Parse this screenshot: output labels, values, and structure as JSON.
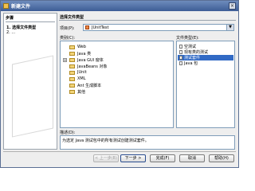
{
  "window": {
    "title": "新建文件"
  },
  "steps": {
    "title": "步骤",
    "items": [
      {
        "num": "1.",
        "label": "选择文件类型",
        "current": true
      },
      {
        "num": "2.",
        "label": "...",
        "current": false
      }
    ]
  },
  "main": {
    "title": "选择文件类型",
    "project_label": "项目(P):",
    "project_value": "JUnitTest",
    "categories_label": "类别(C):",
    "file_types_label": "文件类型(E):",
    "categories": [
      {
        "label": "Web",
        "expandable": false
      },
      {
        "label": "Java 类",
        "expandable": false
      },
      {
        "label": "Java GUI 窗体",
        "expandable": true
      },
      {
        "label": "JavaBeans 对象",
        "expandable": false
      },
      {
        "label": "JUnit",
        "expandable": false
      },
      {
        "label": "XML",
        "expandable": false
      },
      {
        "label": "Ant 生成脚本",
        "expandable": false
      },
      {
        "label": "其他",
        "expandable": false
      }
    ],
    "file_types": [
      {
        "label": "空测试",
        "selected": false
      },
      {
        "label": "现有类的测试",
        "selected": false
      },
      {
        "label": "测试套件",
        "selected": true
      },
      {
        "label": "Java 包",
        "selected": false
      }
    ],
    "description_label": "描述(D):",
    "description_text": "为选定 Java 测试包中的所有测试创建测试套件。"
  },
  "buttons": {
    "back": "< 上一步(B)",
    "next": "下一步 >",
    "finish": "完成(F)",
    "cancel": "取消",
    "help": "帮助(H)"
  }
}
